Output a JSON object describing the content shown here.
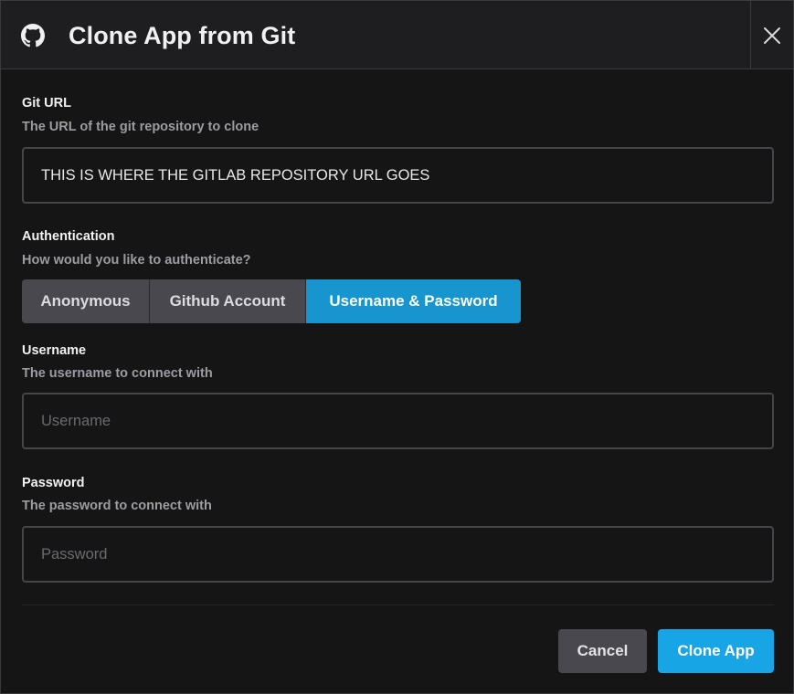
{
  "dialog": {
    "title": "Clone App from Git"
  },
  "git_url": {
    "label": "Git URL",
    "description": "The URL of the git repository to clone",
    "value": "THIS IS WHERE THE GITLAB REPOSITORY URL GOES"
  },
  "authentication": {
    "label": "Authentication",
    "description": "How would you like to authenticate?",
    "options": [
      "Anonymous",
      "Github Account",
      "Username & Password"
    ],
    "selected": "Username & Password"
  },
  "username": {
    "label": "Username",
    "description": "The username to connect with",
    "value": "",
    "placeholder": "Username"
  },
  "password": {
    "label": "Password",
    "description": "The password to connect with",
    "value": "",
    "placeholder": "Password"
  },
  "footer": {
    "cancel_label": "Cancel",
    "clone_label": "Clone App"
  },
  "colors": {
    "accent": "#18a5e6",
    "selected_segment": "#1795cf",
    "neutral_button": "#48484e"
  },
  "icons": {
    "header": "github-icon",
    "close": "close-icon"
  }
}
